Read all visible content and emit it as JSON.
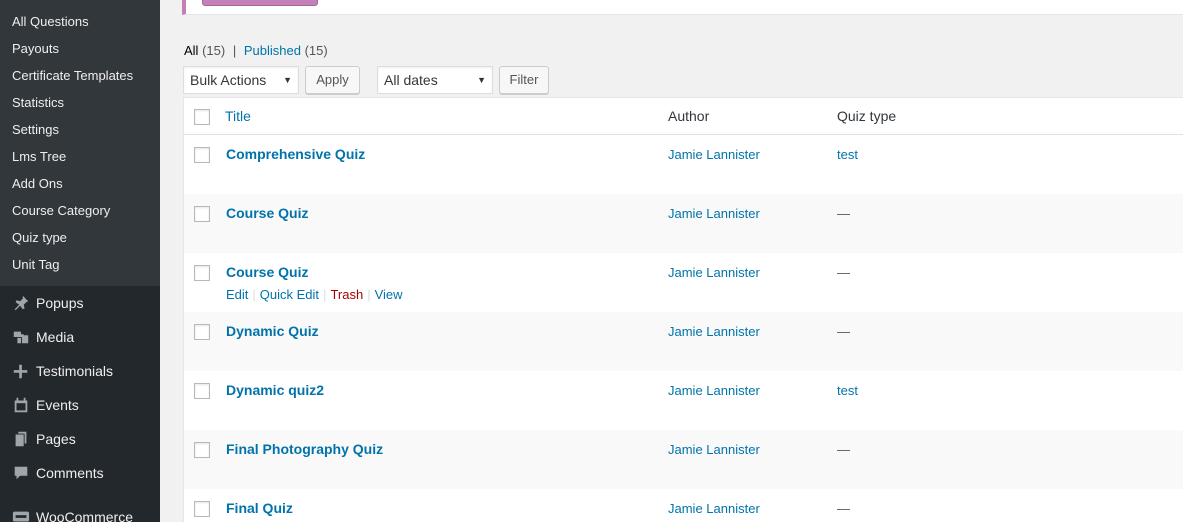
{
  "sidebar": {
    "submenu": [
      "All Questions",
      "Payouts",
      "Certificate Templates",
      "Statistics",
      "Settings",
      "Lms Tree",
      "Add Ons",
      "Course Category",
      "Quiz type",
      "Unit Tag"
    ],
    "menu": [
      {
        "label": "Popups",
        "icon": "pin-icon"
      },
      {
        "label": "Media",
        "icon": "media-icon"
      },
      {
        "label": "Testimonials",
        "icon": "plus-icon"
      },
      {
        "label": "Events",
        "icon": "calendar-icon"
      },
      {
        "label": "Pages",
        "icon": "pages-icon"
      },
      {
        "label": "Comments",
        "icon": "comment-icon"
      },
      {
        "label": "WooCommerce",
        "icon": "woocommerce-icon"
      }
    ]
  },
  "views": {
    "all_label": "All",
    "all_count": "(15)",
    "separator": "|",
    "published_label": "Published",
    "published_count": "(15)"
  },
  "toolbar": {
    "bulk_actions": "Bulk Actions",
    "apply": "Apply",
    "dates": "All dates",
    "filter": "Filter"
  },
  "table": {
    "columns": {
      "title": "Title",
      "author": "Author",
      "quiz_type": "Quiz type"
    },
    "row_actions": {
      "edit": "Edit",
      "quick_edit": "Quick Edit",
      "trash": "Trash",
      "view": "View",
      "sep": "|"
    },
    "rows": [
      {
        "title": "Comprehensive Quiz",
        "author": "Jamie Lannister",
        "quiz_type": "test"
      },
      {
        "title": "Course Quiz",
        "author": "Jamie Lannister",
        "quiz_type": "—"
      },
      {
        "title": "Course Quiz",
        "author": "Jamie Lannister",
        "quiz_type": "—"
      },
      {
        "title": "Dynamic Quiz",
        "author": "Jamie Lannister",
        "quiz_type": "—"
      },
      {
        "title": "Dynamic quiz2",
        "author": "Jamie Lannister",
        "quiz_type": "test"
      },
      {
        "title": "Final Photography Quiz",
        "author": "Jamie Lannister",
        "quiz_type": "—"
      },
      {
        "title": "Final Quiz",
        "author": "Jamie Lannister",
        "quiz_type": "—"
      }
    ]
  },
  "colors": {
    "link": "#0073aa",
    "sidebar": "#23282d",
    "submenu": "#32373c",
    "trash": "#aa0000",
    "notice_accent": "#c37fb8"
  }
}
